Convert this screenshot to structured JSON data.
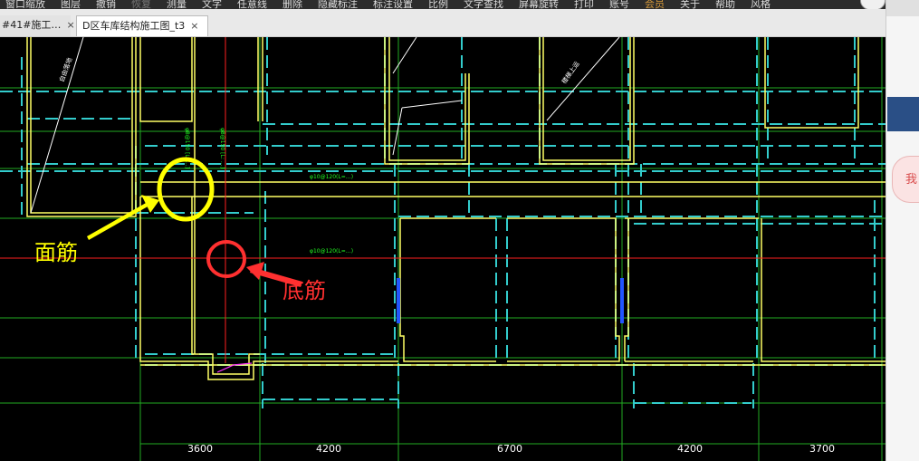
{
  "menu": {
    "items": [
      {
        "label": "窗口缩放",
        "state": "normal"
      },
      {
        "label": "图层",
        "state": "normal"
      },
      {
        "label": "撤销",
        "state": "normal"
      },
      {
        "label": "恢复",
        "state": "disabled"
      },
      {
        "label": "测量",
        "state": "normal"
      },
      {
        "label": "文字",
        "state": "normal"
      },
      {
        "label": "任意线",
        "state": "normal"
      },
      {
        "label": "删除",
        "state": "normal"
      },
      {
        "label": "隐藏标注",
        "state": "normal"
      },
      {
        "label": "标注设置",
        "state": "normal"
      },
      {
        "label": "比例",
        "state": "normal"
      },
      {
        "label": "文字查找",
        "state": "normal"
      },
      {
        "label": "屏幕旋转",
        "state": "normal"
      },
      {
        "label": "打印",
        "state": "normal"
      },
      {
        "label": "账号",
        "state": "normal"
      },
      {
        "label": "会员",
        "state": "vip"
      },
      {
        "label": "关于",
        "state": "normal"
      },
      {
        "label": "帮助",
        "state": "normal"
      },
      {
        "label": "风格",
        "state": "normal"
      }
    ]
  },
  "tabs": [
    {
      "label": "#41#施工…",
      "close": "×"
    },
    {
      "label": "D区车库结构施工图_t3",
      "close": "×"
    }
  ],
  "side": {
    "icon_text": "我"
  },
  "colors": {
    "background": "#000000",
    "wall": "#ffff66",
    "dashed": "#33cccc",
    "grid": "#22aa22",
    "red_line": "#ff2020",
    "annotation_yellow": "#ffff00",
    "annotation_red": "#ff3030",
    "green_text": "#22ff22"
  },
  "drawing": {
    "rebar_labels": [
      "φ8@150 [L: …]",
      "φ8@150 [L: …]",
      "φ10@120(L=…)",
      "φ10@120(L=…)"
    ],
    "slab_notes": [
      "自由落地",
      "楼梯上运"
    ],
    "dimensions": [
      "3600",
      "4200",
      "6700",
      "4200",
      "3700"
    ]
  },
  "annotations": {
    "top_rebar": "面筋",
    "bottom_rebar": "底筋"
  }
}
